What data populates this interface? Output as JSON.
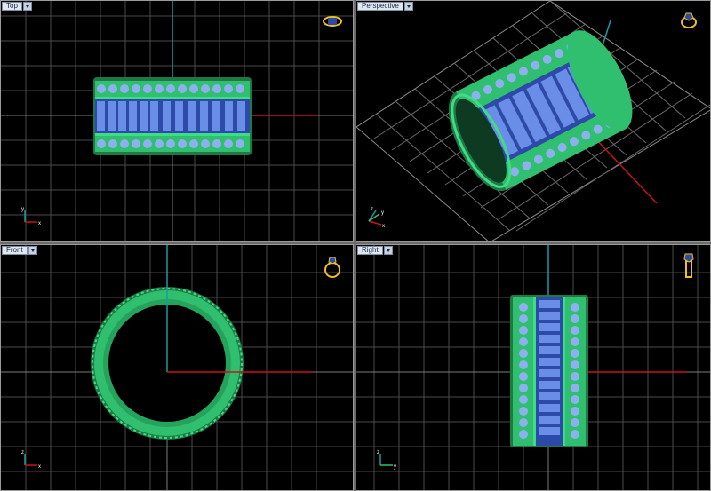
{
  "viewports": {
    "top": {
      "label": "Top"
    },
    "perspective": {
      "label": "Perspective"
    },
    "front": {
      "label": "Front"
    },
    "right": {
      "label": "Right"
    }
  },
  "axes": {
    "x": "x",
    "y": "y",
    "z": "z"
  },
  "colors": {
    "background": "#000000",
    "grid": "#5a5a5a",
    "grid_major": "#8c8c8c",
    "x_axis": "#c8141e",
    "y_axis": "#1a9aa6",
    "metal": "#2fbf6e",
    "metal_dark": "#1d7a44",
    "gem": "#6a8ee8",
    "gem_dark": "#2e4aa8",
    "icon": "#f0c020"
  }
}
